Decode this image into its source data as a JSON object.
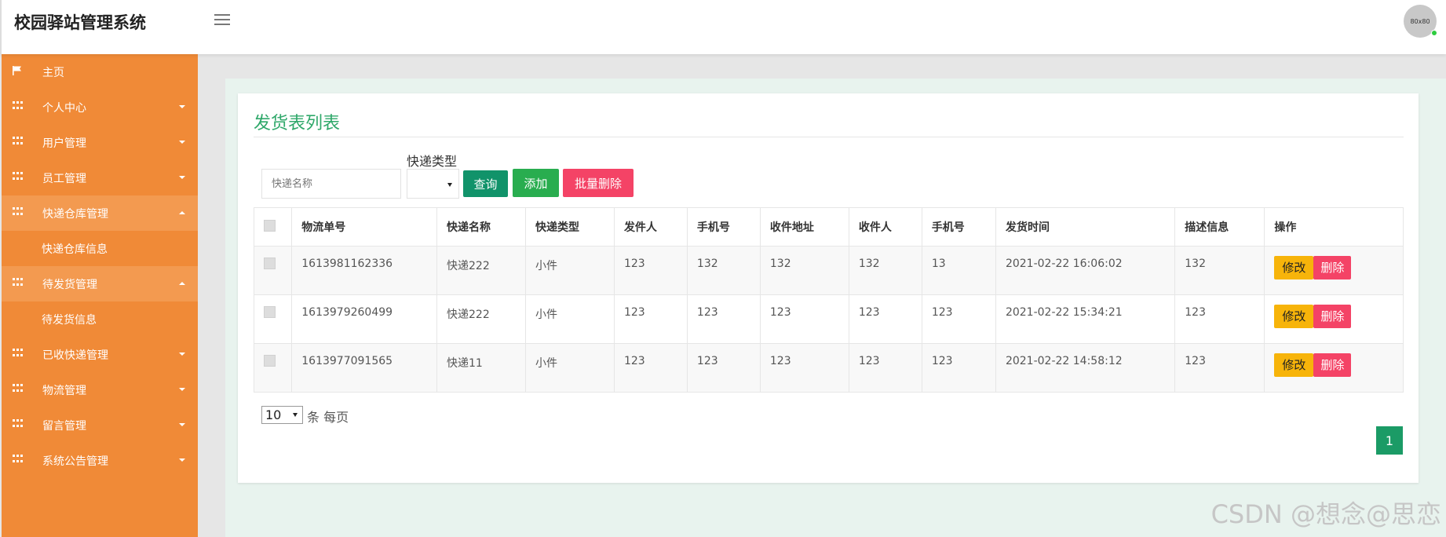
{
  "header": {
    "brand": "校园驿站管理系统",
    "avatar_text": "80x80"
  },
  "sidebar": {
    "items": [
      {
        "label": "主页",
        "icon": "flag-icon",
        "state": "none"
      },
      {
        "label": "个人中心",
        "icon": "grid-icon",
        "state": "collapsed"
      },
      {
        "label": "用户管理",
        "icon": "grid-icon",
        "state": "collapsed"
      },
      {
        "label": "员工管理",
        "icon": "grid-icon",
        "state": "collapsed"
      },
      {
        "label": "快递仓库管理",
        "icon": "grid-icon",
        "state": "expanded"
      },
      {
        "label": "快递仓库信息",
        "sub": true
      },
      {
        "label": "待发货管理",
        "icon": "grid-icon",
        "state": "expanded"
      },
      {
        "label": "待发货信息",
        "sub": true
      },
      {
        "label": "已收快递管理",
        "icon": "grid-icon",
        "state": "collapsed"
      },
      {
        "label": "物流管理",
        "icon": "grid-icon",
        "state": "collapsed"
      },
      {
        "label": "留言管理",
        "icon": "grid-icon",
        "state": "collapsed"
      },
      {
        "label": "系统公告管理",
        "icon": "grid-icon",
        "state": "collapsed"
      }
    ]
  },
  "main": {
    "title": "发货表列表",
    "search_placeholder": "快递名称",
    "type_label": "快递类型",
    "buttons": {
      "query": "查询",
      "add": "添加",
      "batch_delete": "批量删除"
    },
    "table": {
      "headers": [
        "物流单号",
        "快递名称",
        "快递类型",
        "发件人",
        "手机号",
        "收件地址",
        "收件人",
        "手机号",
        "发货时间",
        "描述信息",
        "操作"
      ],
      "rows": [
        [
          "1613981162336",
          "快递222",
          "小件",
          "123",
          "132",
          "132",
          "132",
          "13",
          "2021-02-22 16:06:02",
          "132"
        ],
        [
          "1613979260499",
          "快递222",
          "小件",
          "123",
          "123",
          "123",
          "123",
          "123",
          "2021-02-22 15:34:21",
          "123"
        ],
        [
          "1613977091565",
          "快递11",
          "小件",
          "123",
          "123",
          "123",
          "123",
          "123",
          "2021-02-22 14:58:12",
          "123"
        ]
      ],
      "edit_label": "修改",
      "delete_label": "删除"
    },
    "pagination": {
      "page_size": "10",
      "page_size_text": "条 每页",
      "current_page": "1"
    }
  },
  "watermark": "CSDN @想念@思恋",
  "colors": {
    "sidebar": "#f08a37",
    "accent_green": "#2fa86a",
    "query": "#11936a",
    "add": "#29ad4f",
    "delete": "#f44366",
    "edit": "#f7b40a"
  }
}
